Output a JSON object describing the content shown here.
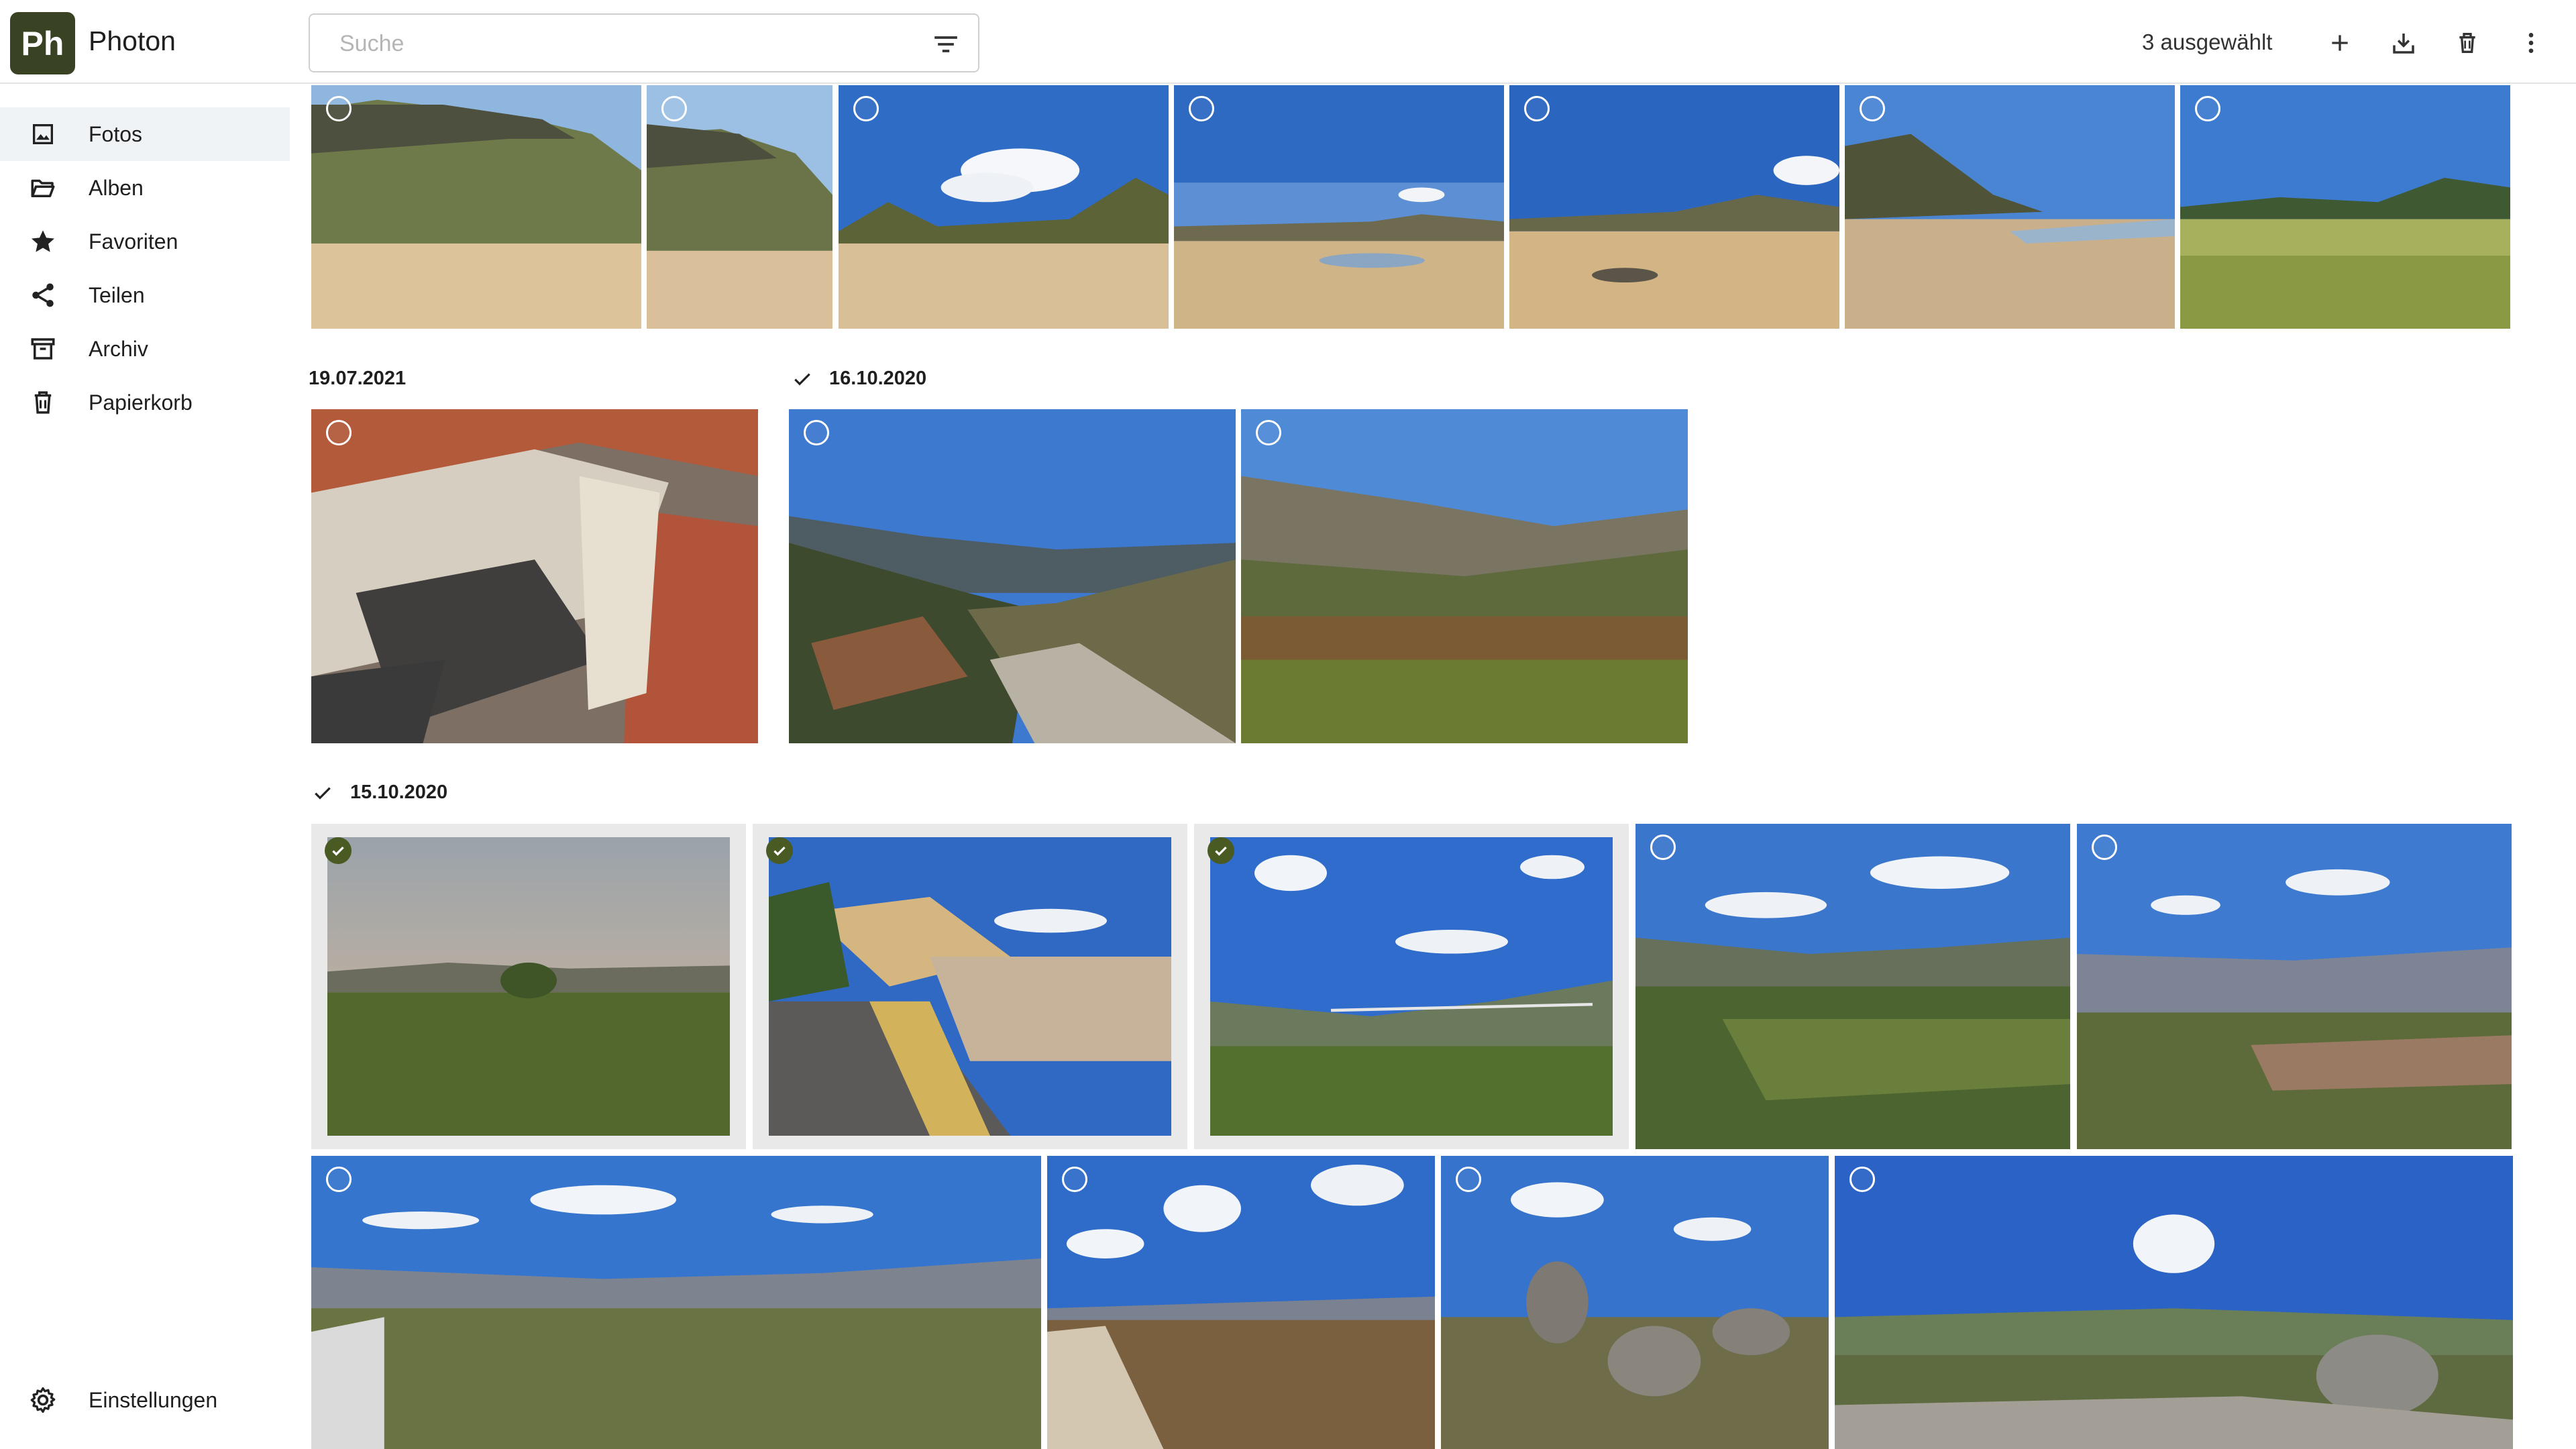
{
  "app": {
    "logo": "Ph",
    "name": "Photon"
  },
  "search": {
    "placeholder": "Suche",
    "value": ""
  },
  "header": {
    "selected_count": "3 ausgewählt",
    "icons": [
      "plus-icon",
      "download-icon",
      "trash-icon",
      "more-vert-icon"
    ]
  },
  "sidebar": {
    "items": [
      {
        "label": "Fotos",
        "icon": "photo-icon",
        "active": true
      },
      {
        "label": "Alben",
        "icon": "folder-open-icon"
      },
      {
        "label": "Favoriten",
        "icon": "star-icon"
      },
      {
        "label": "Teilen",
        "icon": "share-icon"
      },
      {
        "label": "Archiv",
        "icon": "archive-icon"
      },
      {
        "label": "Papierkorb",
        "icon": "trash-icon"
      }
    ],
    "settings_label": "Einstellungen"
  },
  "groups": [
    {
      "date": "19.07.2021",
      "group_checked": false,
      "photos": 1
    },
    {
      "date": "16.10.2020",
      "group_checked": true,
      "photos": 2
    },
    {
      "date": "15.10.2020",
      "group_checked": true,
      "photos": 9,
      "selected_photos": 3
    }
  ],
  "colors": {
    "accent": "#4a5a23",
    "logo_bg": "#3a4224",
    "active_nav_bg": "#f0f3f6"
  }
}
